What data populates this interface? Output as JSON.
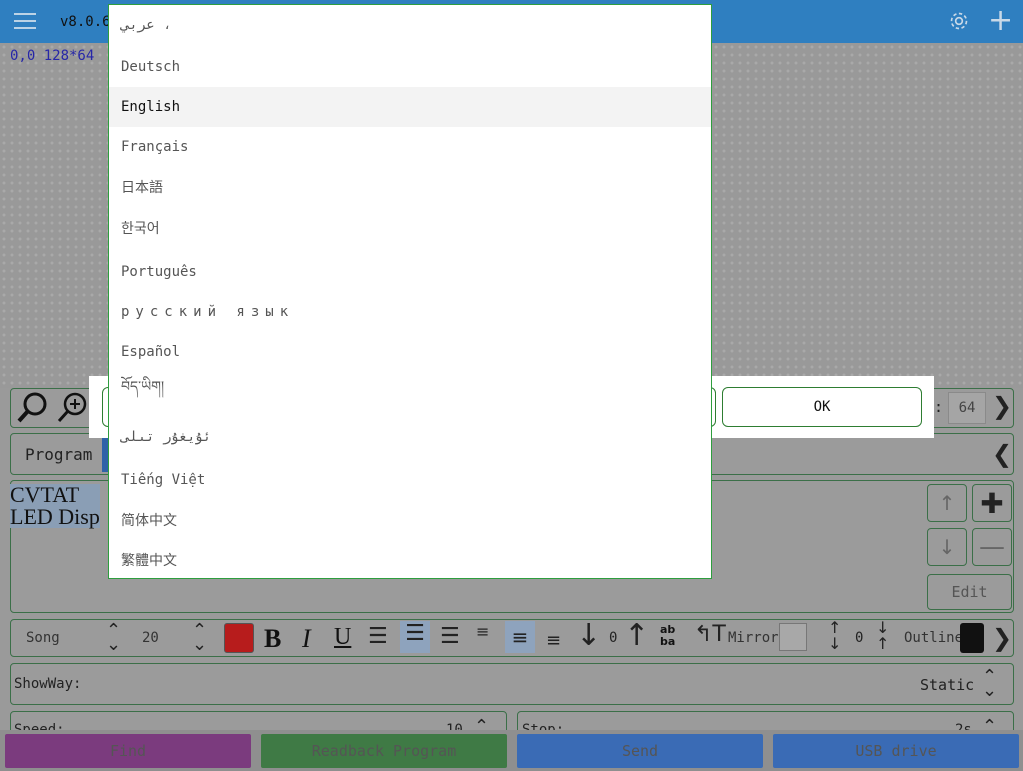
{
  "header": {
    "version": "v8.0.6"
  },
  "canvas": {
    "coords": "0,0 128*64"
  },
  "zoom_row": {
    "height_label": ":",
    "height_value": "64"
  },
  "program_row": {
    "label": "Program"
  },
  "preview": {
    "line1": "CVTAT",
    "line2": "LED Disp"
  },
  "side_buttons": {
    "edit": "Edit"
  },
  "format_row": {
    "font": "Song",
    "size": "20",
    "move": "0",
    "mirror": "Mirror",
    "spacing": "0",
    "outline": "Outline",
    "color": "#b71c1c"
  },
  "showway": {
    "label": "ShowWay:",
    "value": "Static"
  },
  "speed": {
    "label": "Speed:",
    "value": "10"
  },
  "stop": {
    "label": "Stop:",
    "value": "2s"
  },
  "bottom_bar": {
    "find": "Find",
    "readback": "Readback Program",
    "send": "Send",
    "usb": "USB drive",
    "colors": {
      "find": "#7b3b7e",
      "readback": "#3f7a45",
      "send": "#3a6bb5",
      "usb": "#3a6bb5"
    }
  },
  "dialog": {
    "ok": "OK"
  },
  "languages": [
    {
      "label": "عربي ،",
      "selected": false
    },
    {
      "label": "Deutsch",
      "selected": false
    },
    {
      "label": "English",
      "selected": true
    },
    {
      "label": "Français",
      "selected": false
    },
    {
      "label": "日本語",
      "selected": false
    },
    {
      "label": "한국어",
      "selected": false
    },
    {
      "label": "Português",
      "selected": false
    },
    {
      "label": "русский язык",
      "selected": false
    },
    {
      "label": "Español",
      "selected": false
    },
    {
      "label": "བོད་ཡིག།",
      "selected": false
    },
    {
      "label": "ئۇيغۇر تىلى",
      "selected": false
    },
    {
      "label": "Tiếng Việt",
      "selected": false
    },
    {
      "label": "简体中文",
      "selected": false
    },
    {
      "label": "繁體中文",
      "selected": false
    }
  ]
}
